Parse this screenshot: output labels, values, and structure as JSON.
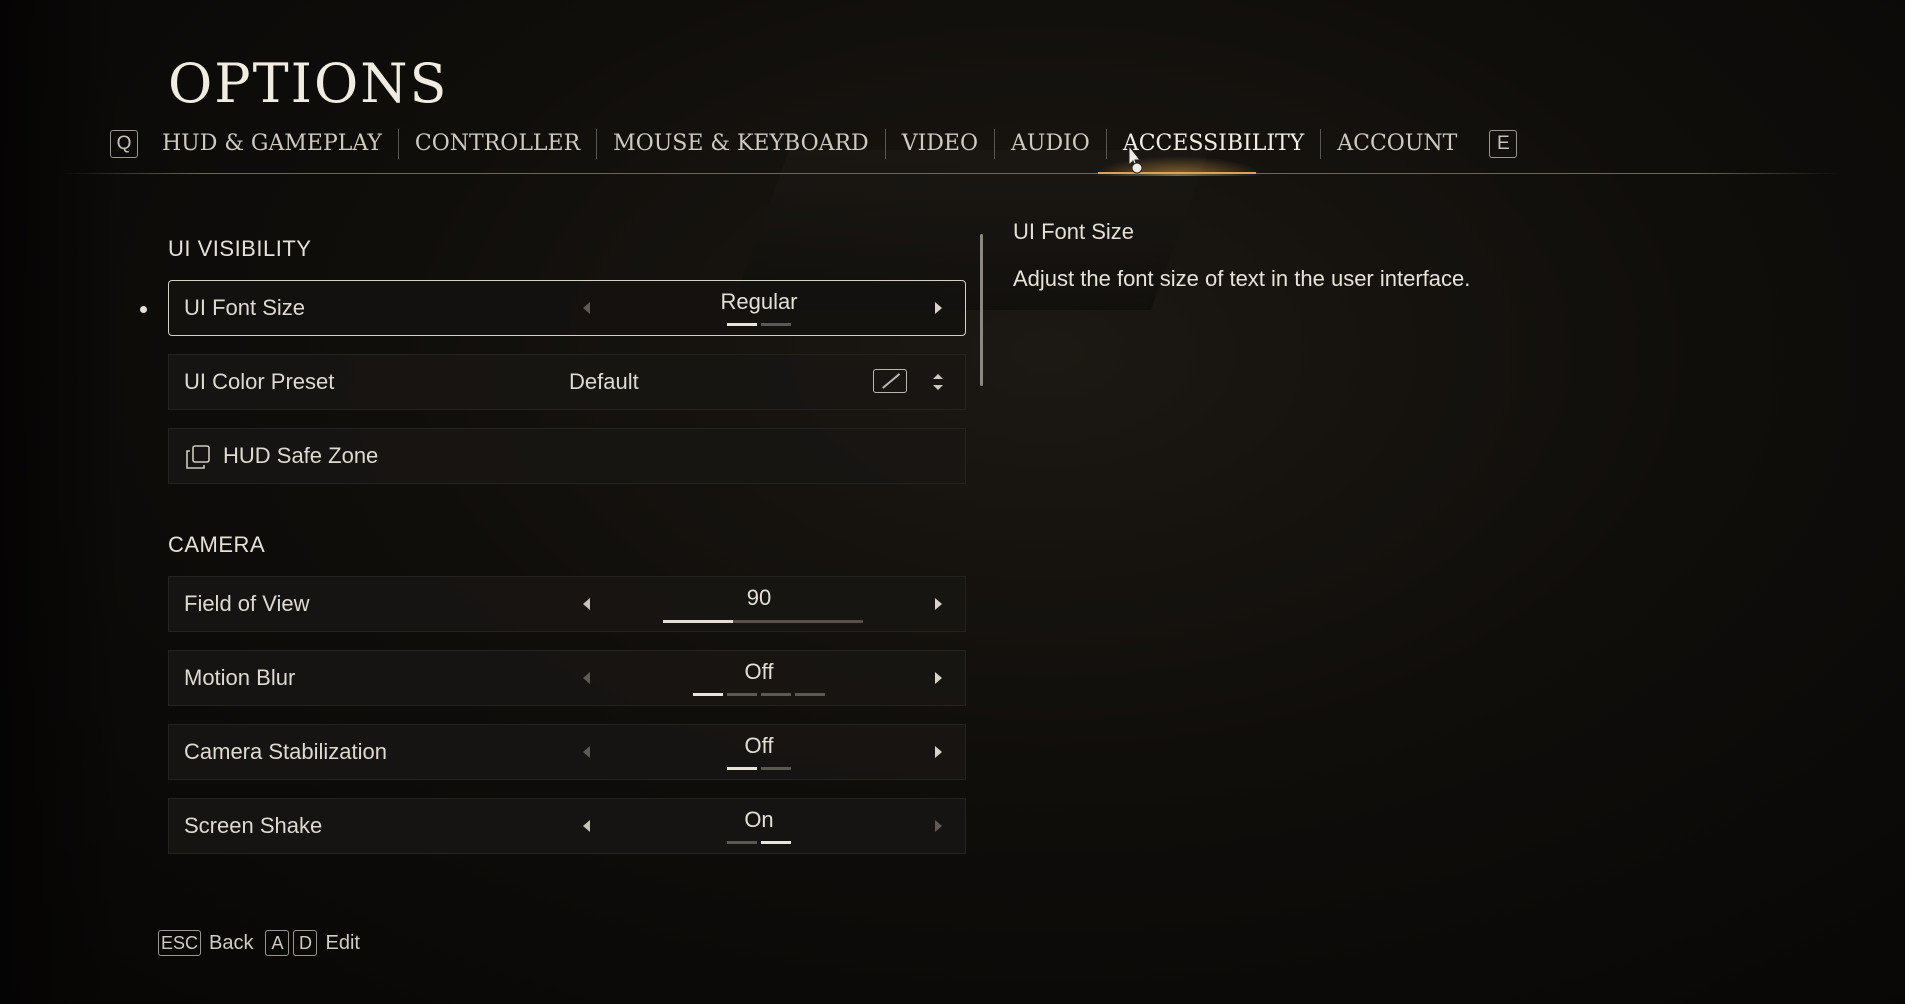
{
  "header": {
    "title": "OPTIONS"
  },
  "tabs": {
    "prev_key": "Q",
    "next_key": "E",
    "items": [
      {
        "label": "HUD & GAMEPLAY"
      },
      {
        "label": "CONTROLLER"
      },
      {
        "label": "MOUSE & KEYBOARD"
      },
      {
        "label": "VIDEO"
      },
      {
        "label": "AUDIO"
      },
      {
        "label": "ACCESSIBILITY",
        "active": true
      },
      {
        "label": "ACCOUNT"
      }
    ]
  },
  "sections": {
    "ui_visibility": {
      "label": "UI VISIBILITY",
      "font_size": {
        "label": "UI Font Size",
        "value": "Regular",
        "option_count": 2,
        "selected_index": 0
      },
      "color_preset": {
        "label": "UI Color Preset",
        "value": "Default"
      },
      "safe_zone": {
        "label": "HUD Safe Zone"
      }
    },
    "camera": {
      "label": "CAMERA",
      "fov": {
        "label": "Field of View",
        "value": "90",
        "slider_fraction": 0.35
      },
      "motion_blur": {
        "label": "Motion Blur",
        "value": "Off",
        "option_count": 4,
        "selected_index": 0
      },
      "stabilization": {
        "label": "Camera Stabilization",
        "value": "Off",
        "option_count": 2,
        "selected_index": 0
      },
      "screen_shake": {
        "label": "Screen Shake",
        "value": "On",
        "option_count": 2,
        "selected_index": 1
      }
    }
  },
  "description": {
    "title": "UI Font Size",
    "text": "Adjust the font size of text in the user interface."
  },
  "footer": {
    "back_key": "ESC",
    "back_label": "Back",
    "edit_key_1": "A",
    "edit_key_2": "D",
    "edit_label": "Edit"
  },
  "colors": {
    "accent": "#d9a45a",
    "background": "#100e0b",
    "text": "#e3dfd5"
  }
}
